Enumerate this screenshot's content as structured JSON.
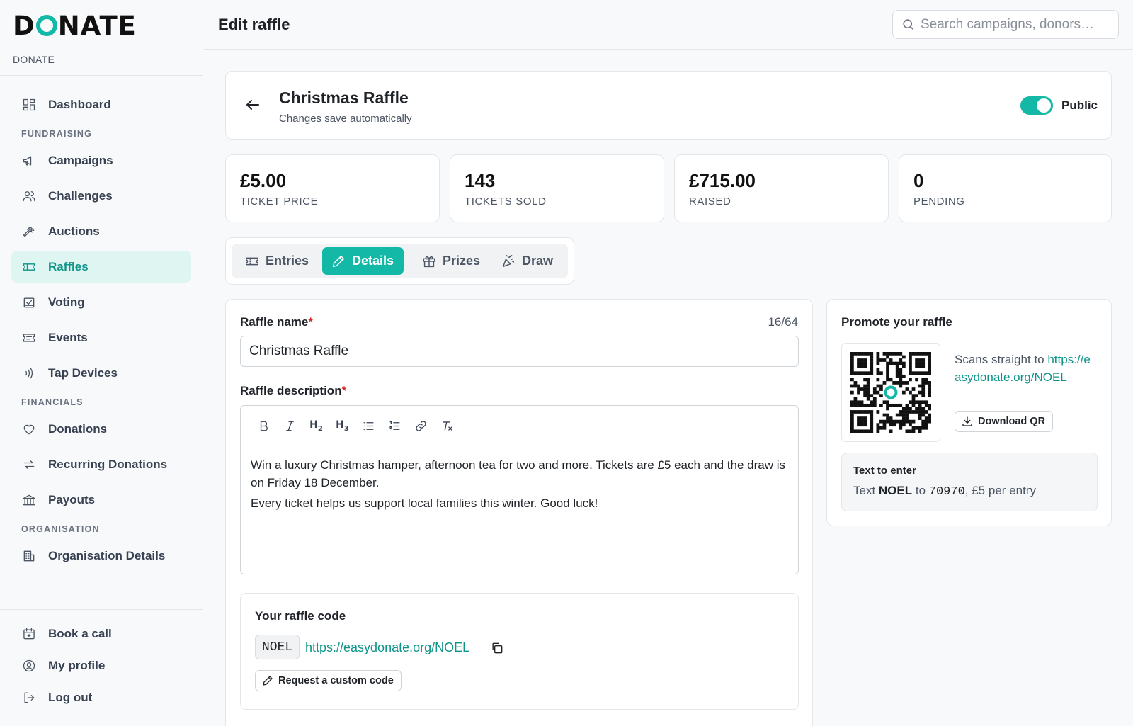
{
  "brand": {
    "logo_pre": "D",
    "logo_post": "NATE",
    "subtitle": "DONATE"
  },
  "header": {
    "title": "Edit raffle",
    "search_placeholder": "Search campaigns, donors…"
  },
  "sidebar": {
    "items": [
      {
        "label": "Dashboard"
      },
      {
        "section": "FUNDRAISING"
      },
      {
        "label": "Campaigns"
      },
      {
        "label": "Challenges"
      },
      {
        "label": "Auctions"
      },
      {
        "label": "Raffles",
        "active": true
      },
      {
        "label": "Voting"
      },
      {
        "label": "Events"
      },
      {
        "label": "Tap Devices"
      },
      {
        "section": "FINANCIALS"
      },
      {
        "label": "Donations"
      },
      {
        "label": "Recurring Donations"
      },
      {
        "label": "Payouts"
      },
      {
        "section": "ORGANISATION"
      },
      {
        "label": "Organisation Details"
      }
    ],
    "bottom": [
      {
        "label": "Book a call"
      },
      {
        "label": "My profile"
      },
      {
        "label": "Log out"
      }
    ]
  },
  "raffle": {
    "title": "Christmas Raffle",
    "subtitle": "Changes save automatically",
    "visibility_label": "Public",
    "public": true
  },
  "stats": [
    {
      "value": "£5.00",
      "label": "TICKET PRICE"
    },
    {
      "value": "143",
      "label": "TICKETS SOLD"
    },
    {
      "value": "£715.00",
      "label": "RAISED"
    },
    {
      "value": "0",
      "label": "PENDING"
    }
  ],
  "tabs": [
    {
      "label": "Entries"
    },
    {
      "label": "Details",
      "active": true
    },
    {
      "label": "Prizes"
    },
    {
      "label": "Draw"
    }
  ],
  "form": {
    "name_label": "Raffle name",
    "required_mark": "*",
    "name_counter": "16/64",
    "name_value": "Christmas Raffle",
    "description_label": "Raffle description",
    "toolbar": [
      "bold",
      "italic",
      "heading-2",
      "heading-3",
      "bullet-list",
      "numbered-list",
      "link",
      "clear-format"
    ],
    "description_paragraphs": [
      "Win a luxury Christmas hamper, afternoon tea for two and more. Tickets are £5 each and the draw is on Friday 18 December.",
      "Every ticket helps us support local families this winter. Good luck!"
    ]
  },
  "code": {
    "title": "Your raffle code",
    "code": "NOEL",
    "link": "https://easydonate.org/NOEL",
    "request_label": "Request a custom code"
  },
  "promote": {
    "title": "Promote your raffle",
    "scan_prefix": "Scans straight to ",
    "scan_link": "https://easydonate.org/NOEL",
    "download_label": "Download QR",
    "text_title": "Text to enter",
    "text_prefix": "Text ",
    "text_code": "NOEL",
    "text_mid": " to ",
    "text_number": "70970",
    "text_suffix": ", £5 per entry"
  },
  "colors": {
    "accent": "#14b8a6",
    "accent_dark": "#0d9488",
    "active_bg": "#dff5f1",
    "required": "#dc2626"
  }
}
